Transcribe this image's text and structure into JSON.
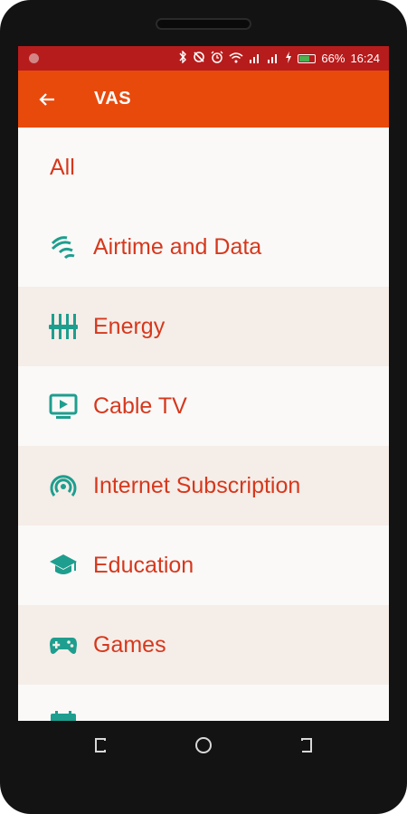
{
  "status_bar": {
    "battery": "66%",
    "time": "16:24",
    "battery_level": 0.66,
    "icons": [
      "bluetooth-icon",
      "sync-icon",
      "alarm-icon",
      "wifi-icon",
      "signal-icon",
      "signal-icon",
      "charging-icon",
      "battery-icon"
    ]
  },
  "app_bar": {
    "title": "VAS",
    "back_icon": "arrow-left-icon"
  },
  "colors": {
    "status_bar": "#b71c1c",
    "app_bar": "#e84a0c",
    "label": "#d6381c",
    "icon": "#1e9e8e",
    "alt_row": "#f5ede8"
  },
  "categories": [
    {
      "label": "All",
      "icon": ""
    },
    {
      "label": "Airtime and Data",
      "icon": "signal-waves-icon"
    },
    {
      "label": "Energy",
      "icon": "equalizer-icon"
    },
    {
      "label": "Cable TV",
      "icon": "tv-play-icon"
    },
    {
      "label": "Internet Subscription",
      "icon": "broadcast-icon"
    },
    {
      "label": "Education",
      "icon": "graduation-cap-icon"
    },
    {
      "label": "Games",
      "icon": "gamepad-icon"
    },
    {
      "label": "",
      "icon": "calendar-icon"
    }
  ]
}
